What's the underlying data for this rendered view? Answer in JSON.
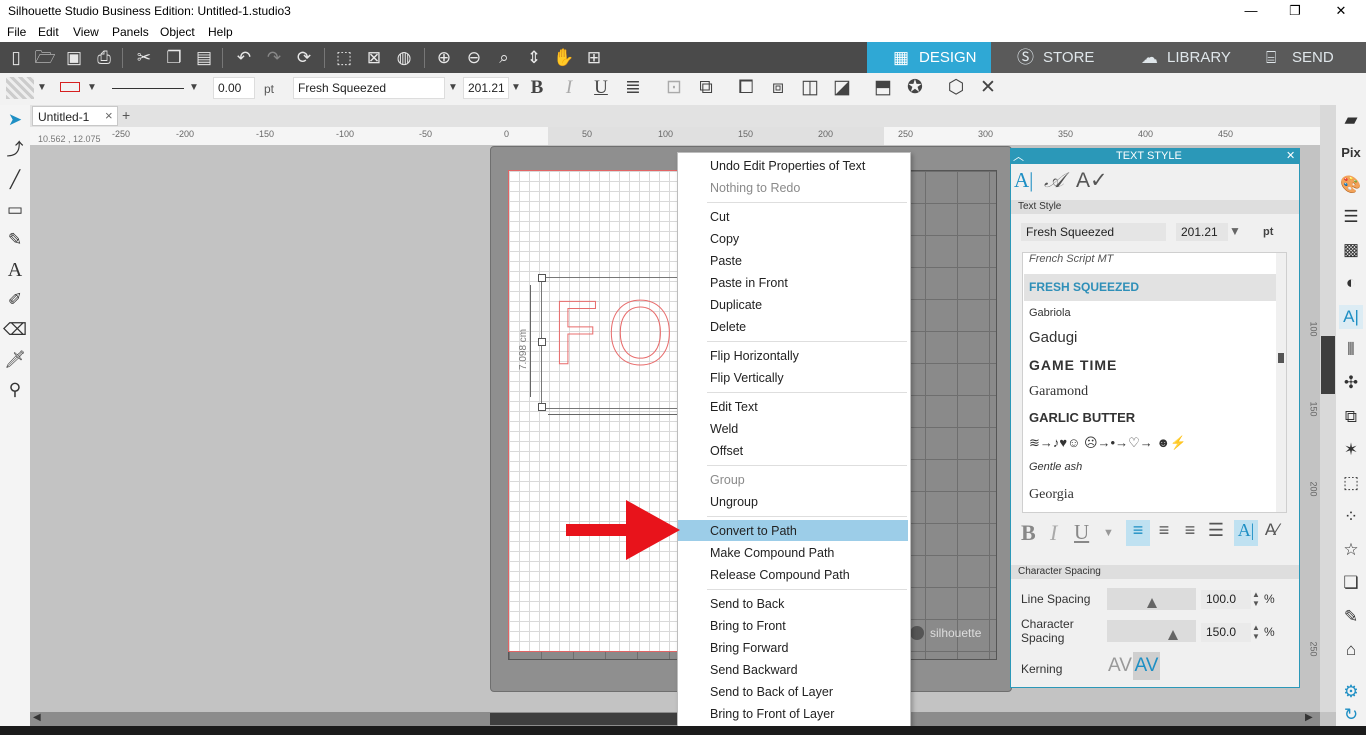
{
  "window": {
    "title": "Silhouette Studio Business Edition: Untitled-1.studio3",
    "minimize": "—",
    "restore": "❐",
    "close": "✕"
  },
  "menu": [
    "File",
    "Edit",
    "View",
    "Panels",
    "Object",
    "Help"
  ],
  "top_tabs": {
    "design": "DESIGN",
    "store": "STORE",
    "library": "LIBRARY",
    "send": "SEND"
  },
  "props": {
    "line_width": "0.00",
    "line_unit": "pt",
    "font": "Fresh Squeezed",
    "font_size": "201.21"
  },
  "doc_tab": {
    "name": "Untitled-1",
    "close": "×",
    "add": "+"
  },
  "ruler": {
    "coords": "10.562 , 12.075",
    "labels": [
      "-250",
      "-200",
      "-150",
      "-100",
      "-50",
      "0",
      "50",
      "100",
      "150",
      "200",
      "250",
      "300",
      "350",
      "400",
      "450"
    ]
  },
  "vruler_labels": [
    "100",
    "150",
    "200",
    "250"
  ],
  "canvas": {
    "dimension_label": "7.098 cm",
    "sample_text": "FO",
    "brand": "silhouette"
  },
  "context_menu": [
    {
      "label": "Undo Edit Properties of Text",
      "disabled": false
    },
    {
      "label": "Nothing to Redo",
      "disabled": true
    },
    {
      "label": "Cut",
      "disabled": false
    },
    {
      "label": "Copy",
      "disabled": false
    },
    {
      "label": "Paste",
      "disabled": false
    },
    {
      "label": "Paste in Front",
      "disabled": false
    },
    {
      "label": "Duplicate",
      "disabled": false
    },
    {
      "label": "Delete",
      "disabled": false
    },
    {
      "label": "Flip Horizontally",
      "disabled": false
    },
    {
      "label": "Flip Vertically",
      "disabled": false
    },
    {
      "label": "Edit Text",
      "disabled": false
    },
    {
      "label": "Weld",
      "disabled": false
    },
    {
      "label": "Offset",
      "disabled": false
    },
    {
      "label": "Group",
      "disabled": true
    },
    {
      "label": "Ungroup",
      "disabled": false
    },
    {
      "label": "Convert to Path",
      "disabled": false,
      "highlighted": true
    },
    {
      "label": "Make Compound Path",
      "disabled": false
    },
    {
      "label": "Release Compound Path",
      "disabled": false
    },
    {
      "label": "Send to Back",
      "disabled": false
    },
    {
      "label": "Bring to Front",
      "disabled": false
    },
    {
      "label": "Bring Forward",
      "disabled": false
    },
    {
      "label": "Send Backward",
      "disabled": false
    },
    {
      "label": "Send to Back of Layer",
      "disabled": false
    },
    {
      "label": "Bring to Front of Layer",
      "disabled": false
    }
  ],
  "panel": {
    "title": "TEXT STYLE",
    "section_text_style": "Text Style",
    "font": "Fresh Squeezed",
    "size": "201.21",
    "unit": "pt",
    "fonts": [
      "French Script MT",
      "FRESH SQUEEZED",
      "Gabriola",
      "Gadugi",
      "GAME TIME",
      "Garamond",
      "GARLIC BUTTER",
      "≋→♪♥☺ ☹→•→♡→ ☻⚡",
      "Gentle ash",
      "Georgia"
    ],
    "section_spacing": "Character Spacing",
    "line_spacing_label": "Line Spacing",
    "line_spacing": "100.0",
    "char_spacing_label": "Character Spacing",
    "char_spacing": "150.0",
    "percent": "%",
    "kerning_label": "Kerning"
  },
  "colors": {
    "accent": "#2fa8d5",
    "toolbar": "#4a4a4a",
    "highlight": "#9ccde8",
    "arrow": "#e8131b"
  }
}
